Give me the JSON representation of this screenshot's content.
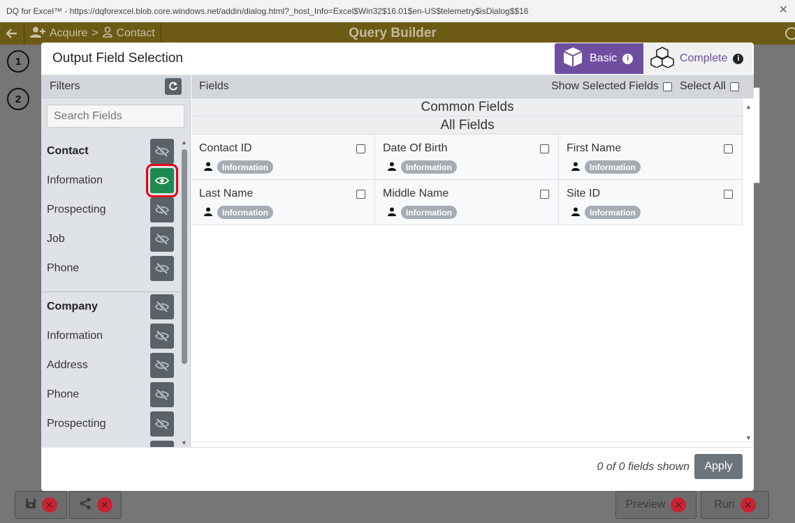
{
  "window": {
    "title": "DQ for Excel™ - https://dqforexcel.blob.core.windows.net/addin/dialog.html?_host_Info=Excel$Win32$16.01$en-US$telemetry$isDialog$$16"
  },
  "appheader": {
    "crumb1": "Acquire",
    "sep": ">",
    "crumb2": "Contact",
    "title": "Query Builder"
  },
  "steps": [
    "1",
    "2"
  ],
  "bottom": {
    "preview": "Preview",
    "run": "Run"
  },
  "modal": {
    "title": "Output Field Selection",
    "basic": "Basic",
    "complete": "Complete",
    "filters": {
      "label": "Filters",
      "search_placeholder": "Search Fields",
      "groups": [
        {
          "name": "Contact",
          "items": [
            "Information",
            "Prospecting",
            "Job",
            "Phone"
          ]
        },
        {
          "name": "Company",
          "items": [
            "Information",
            "Address",
            "Phone",
            "Prospecting"
          ]
        }
      ]
    },
    "fields": {
      "label": "Fields",
      "show_selected": "Show Selected Fields",
      "select_all": "Select All",
      "common": "Common Fields",
      "all": "All Fields",
      "cards": [
        {
          "name": "Contact ID",
          "tag": "Information"
        },
        {
          "name": "Date Of Birth",
          "tag": "Information"
        },
        {
          "name": "First Name",
          "tag": "Information"
        },
        {
          "name": "Last Name",
          "tag": "Information"
        },
        {
          "name": "Middle Name",
          "tag": "Information"
        },
        {
          "name": "Site ID",
          "tag": "Information"
        }
      ]
    },
    "footer": {
      "shown": "0 of 0 fields shown",
      "apply": "Apply"
    }
  },
  "colors": {
    "header": "#6d5a14",
    "basic": "#6f4e9f",
    "eye_active": "#1e8a4f",
    "highlight": "#e4001a"
  }
}
